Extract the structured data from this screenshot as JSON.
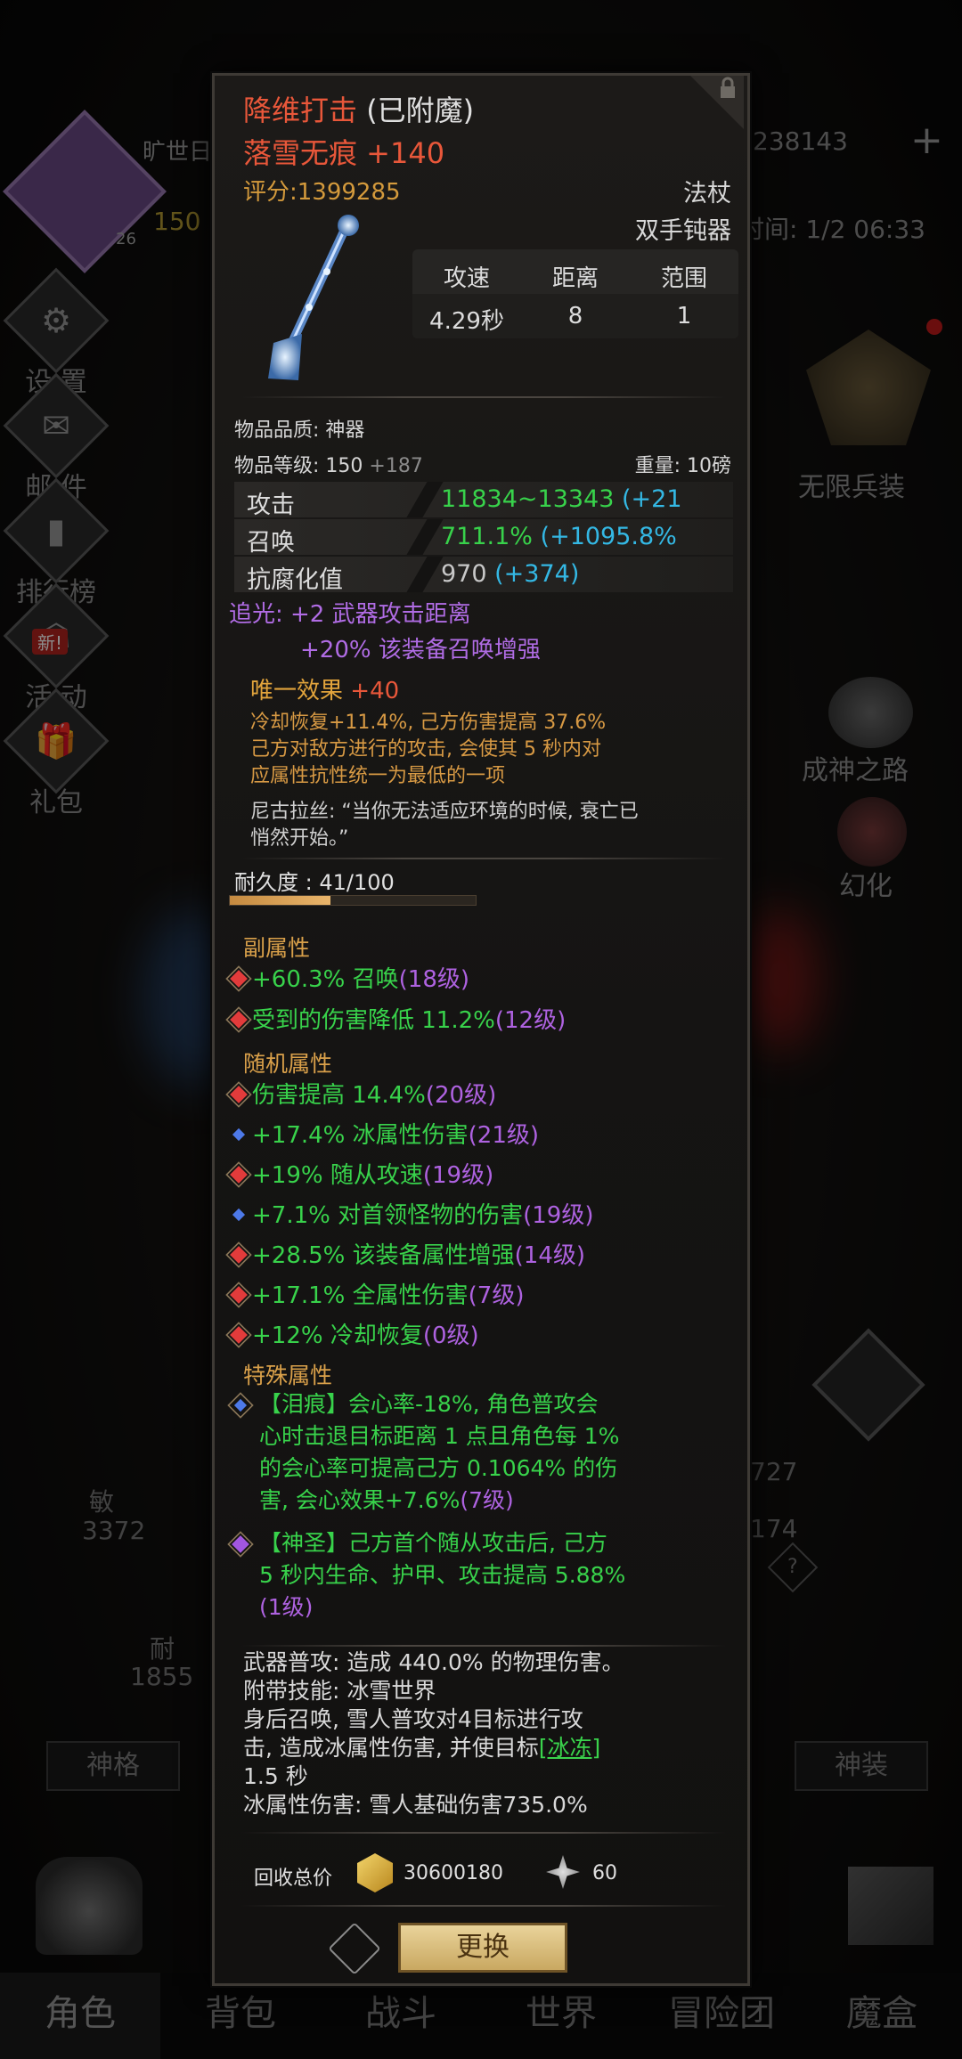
{
  "background": {
    "player_name": "旷世日",
    "level_partial": "150",
    "badge_level": "26",
    "currency_partial": "238143",
    "time_label": "时间: 1/2 06:33",
    "left_menu": [
      {
        "label": "设 置",
        "icon": "gear-icon"
      },
      {
        "label": "邮 件",
        "icon": "mail-icon"
      },
      {
        "label": "排行榜",
        "icon": "ranking-icon"
      },
      {
        "label": "活 动",
        "icon": "event-icon",
        "badge": "新!"
      },
      {
        "label": "礼包",
        "icon": "gift-icon"
      }
    ],
    "right_menu": [
      {
        "label": "无限兵装"
      },
      {
        "label": "成神之路"
      },
      {
        "label": "幻化"
      }
    ],
    "stats": {
      "min_label": "敏",
      "min_val": "3372",
      "nai_label": "耐",
      "nai_val": "1855",
      "r1": "727",
      "r2": "174"
    },
    "chips": {
      "left": "神格",
      "right": "神装"
    },
    "bottom_nav": [
      "角色",
      "背包",
      "战斗",
      "世界",
      "冒险团",
      "魔盒"
    ],
    "active_tab": 0
  },
  "item": {
    "name": "降维打击",
    "enchant_tag": "(已附魔)",
    "enhance": "落雪无痕 +140",
    "score": "评分:1399285",
    "weapon_type": "法杖",
    "weapon_class": "双手钝器",
    "combat_headers": [
      "攻速",
      "距离",
      "范围"
    ],
    "combat_values": [
      "4.29秒",
      "8",
      "1"
    ],
    "quality": "物品品质: 神器",
    "level_label": "物品等级:  150",
    "level_bonus": "+187",
    "weight": "重量:  10磅",
    "main_stats": [
      {
        "label": "攻击",
        "value": "11834~13343",
        "bonus": "(+21",
        "color": "#38d24b"
      },
      {
        "label": "召唤",
        "value": "711.1%",
        "bonus": "(+1095.8%",
        "color": "#38d24b"
      },
      {
        "label": "抗腐化值",
        "value": "970",
        "bonus": "(+374)",
        "color": "#c8c8c8"
      }
    ],
    "enchant_line1": "追光: +2  武器攻击距离",
    "enchant_line2": "+20%  该装备召唤增强",
    "unique_title": "唯一效果",
    "unique_bonus": "+40",
    "unique_desc_1": "冷却恢复+11.4%, 己方伤害提高 37.6%",
    "unique_desc_2": "己方对敌方进行的攻击, 会使其 5 秒内对",
    "unique_desc_3": "应属性抗性统一为最低的一项",
    "lore_1": "尼古拉丝: “当你无法适应环境的时候, 衰亡已",
    "lore_2": "悄然开始。”",
    "durability_label": "耐久度 : 41/100",
    "durability_frac": 0.41,
    "sub_title": "副属性",
    "sub_attrs": [
      {
        "text": "+60.3% 召唤",
        "lv": "(18级)",
        "gem": "red"
      },
      {
        "text": "受到的伤害降低 11.2%",
        "lv": "(12级)",
        "gem": "red"
      }
    ],
    "random_title": "随机属性",
    "random_attrs": [
      {
        "text": "伤害提高 14.4%",
        "lv": "(20级)",
        "gem": "red"
      },
      {
        "text": "+17.4% 冰属性伤害",
        "lv": "(21级)",
        "gem": "blue"
      },
      {
        "text": "+19% 随从攻速",
        "lv": "(19级)",
        "gem": "red"
      },
      {
        "text": "+7.1% 对首领怪物的伤害",
        "lv": "(19级)",
        "gem": "blue"
      },
      {
        "text": "+28.5% 该装备属性增强",
        "lv": "(14级)",
        "gem": "red"
      },
      {
        "text": "+17.1% 全属性伤害",
        "lv": "(7级)",
        "gem": "red"
      },
      {
        "text": "+12% 冷却恢复",
        "lv": "(0级)",
        "gem": "red"
      }
    ],
    "special_title": "特殊属性",
    "special_1_l1": "【泪痕】会心率-18%, 角色普攻会",
    "special_1_l2": "心时击退目标距离 1 点且角色每 1%",
    "special_1_l3": "的会心率可提高己方 0.1064% 的伤",
    "special_1_l4": "害, 会心效果+7.6%",
    "special_1_lv": "(7级)",
    "special_2_l1": "【神圣】己方首个随从攻击后, 己方",
    "special_2_l2": "5 秒内生命、护甲、攻击提高 5.88%",
    "special_2_lv": "(1级)",
    "skill_1": "武器普攻: 造成 440.0% 的物理伤害。",
    "skill_2": "附带技能: 冰雪世界",
    "skill_3": "身后召唤, 雪人普攻对4目标进行攻",
    "skill_4a": "击, 造成冰属性伤害, 并使目标",
    "skill_4_link": "[冰冻]",
    "skill_5": "1.5 秒",
    "skill_6": "冰属性伤害: 雪人基础伤害735.0%",
    "recycle_label": "回收总价",
    "recycle_gold": "30600180",
    "recycle_gem": "60",
    "swap_button": "更换"
  }
}
